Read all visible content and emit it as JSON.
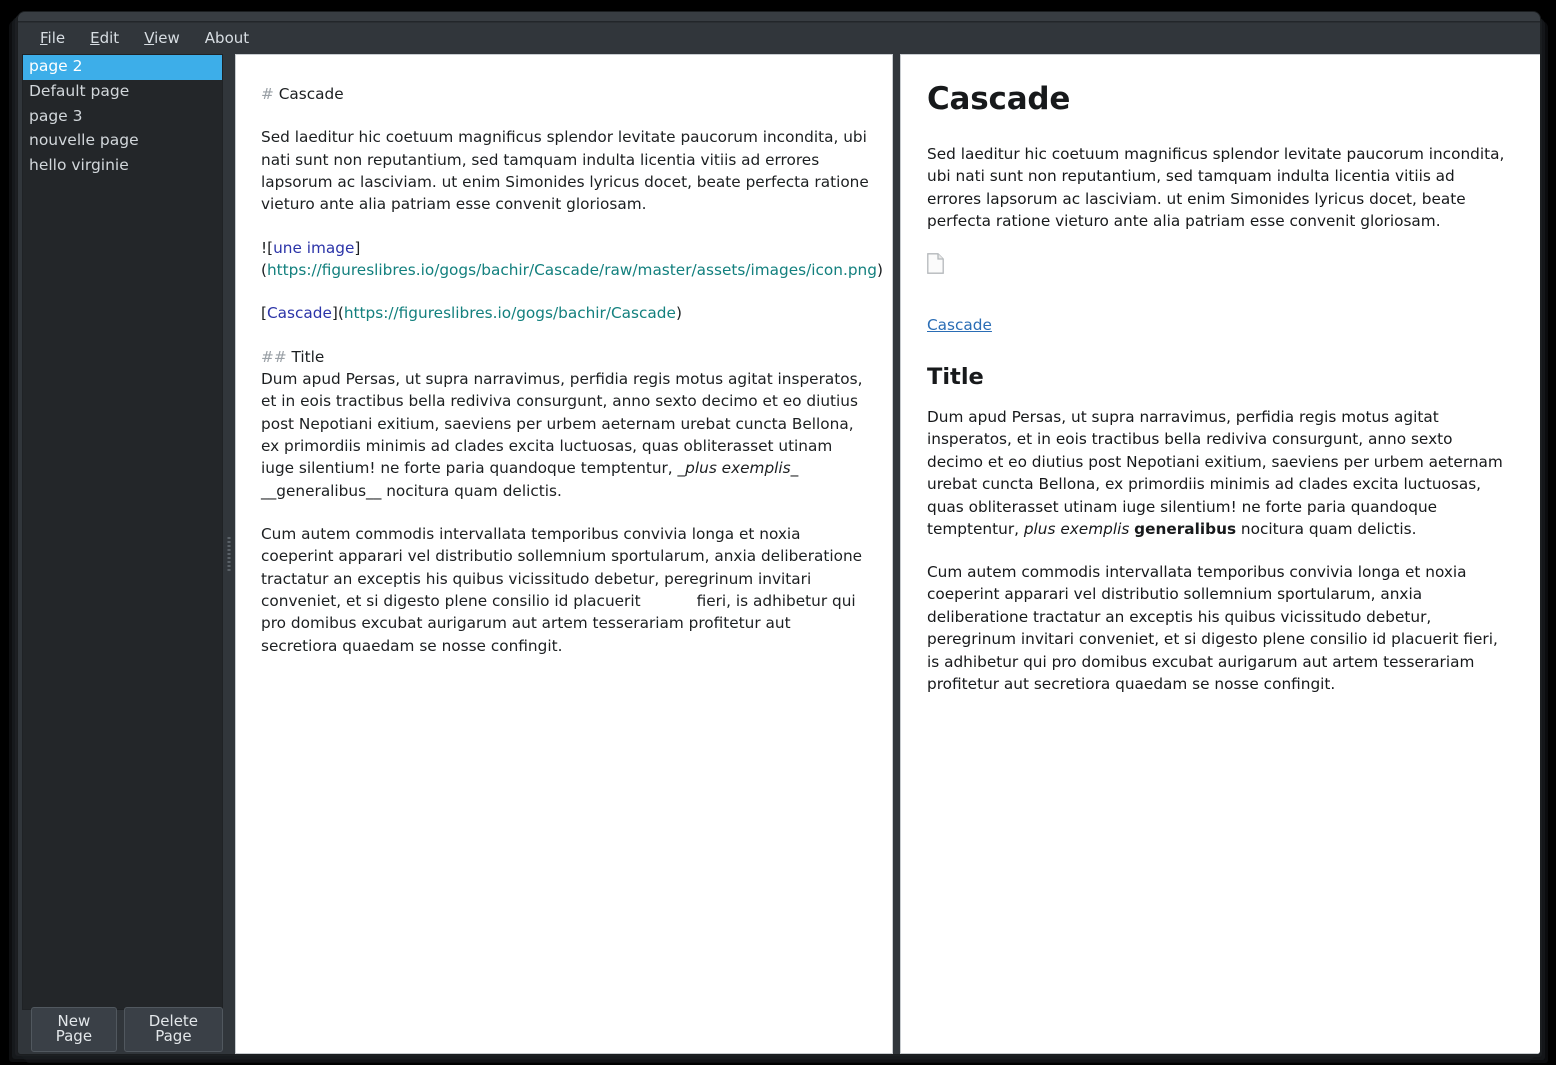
{
  "window": {
    "titlebar_label": ""
  },
  "menubar": {
    "items": [
      {
        "label": "File",
        "mnemonic": "F"
      },
      {
        "label": "Edit",
        "mnemonic": "E"
      },
      {
        "label": "View",
        "mnemonic": "V"
      },
      {
        "label": "About",
        "mnemonic": ""
      }
    ]
  },
  "sidebar": {
    "pages": [
      {
        "label": "page 2",
        "selected": true
      },
      {
        "label": "Default page",
        "selected": false
      },
      {
        "label": "page 3",
        "selected": false
      },
      {
        "label": "nouvelle page",
        "selected": false
      },
      {
        "label": "hello virginie",
        "selected": false
      }
    ],
    "new_page_label": "New Page",
    "delete_page_label": "Delete Page"
  },
  "editor": {
    "heading_marker": "#",
    "heading_text": " Cascade",
    "paragraph1": "Sed laeditur hic coetuum magnificus splendor levitate paucorum incondita, ubi nati sunt non reputantium, sed tamquam indulta licentia vitiis ad errores lapsorum ac lasciviam. ut enim Simonides lyricus docet, beate perfecta ratione vieturo ante alia patriam esse convenit gloriosam.",
    "image_line": {
      "prefix": "![",
      "alt": "une image",
      "mid": "](",
      "url": "https://figureslibres.io/gogs/bachir/Cascade/raw/master/assets/images/icon.png",
      "suffix": ")"
    },
    "link_line": {
      "prefix": "[",
      "text": "Cascade",
      "mid": "](",
      "url": "https://figureslibres.io/gogs/bachir/Cascade",
      "suffix": ")"
    },
    "subheading_marker": "##",
    "subheading_text": " Title",
    "paragraph2_a": "Dum apud Persas, ut supra narravimus, perfidia regis motus agitat insperatos, et in eois tractibus bella rediviva consurgunt, anno sexto decimo et eo diutius post Nepotiani exitium, saeviens per urbem aeternam urebat cuncta Bellona, ex primordiis minimis ad clades excita luctuosas, quas obliterasset utinam iuge silentium! ne forte paria quandoque temptentur, ",
    "paragraph2_italic": "_plus exemplis_",
    "paragraph2_b": " __generalibus__ nocitura quam delictis.",
    "paragraph3_a": "Cum autem commodis intervallata temporibus convivia longa et noxia coeperint apparari vel distributio sollemnium sportularum, anxia deliberatione tractatur an exceptis his quibus vicissitudo debetur, peregrinum invitari conveniet, et si digesto plene consilio id placuerit",
    "paragraph3_b": "fieri, is adhibetur qui pro domibus excubat aurigarum aut artem tesserariam profitetur aut secretiora quaedam se nosse confingit."
  },
  "preview": {
    "h1": "Cascade",
    "paragraph1": "Sed laeditur hic coetuum magnificus splendor levitate paucorum incondita, ubi nati sunt non reputantium, sed tamquam indulta licentia vitiis ad errores lapsorum ac lasciviam. ut enim Simonides lyricus docet, beate perfecta ratione vieturo ante alia patriam esse convenit gloriosam.",
    "broken_image_alt": "une image",
    "link_label": "Cascade",
    "h2": "Title",
    "paragraph2_a": "Dum apud Persas, ut supra narravimus, perfidia regis motus agitat insperatos, et in eois tractibus bella rediviva consurgunt, anno sexto decimo et eo diutius post Nepotiani exitium, saeviens per urbem aeternam urebat cuncta Bellona, ex primordiis minimis ad clades excita luctuosas, quas obliterasset utinam iuge silentium! ne forte paria quandoque temptentur, ",
    "paragraph2_italic": "plus exemplis",
    "paragraph2_bold": "generalibus",
    "paragraph2_b": " nocitura quam delictis.",
    "paragraph3": "Cum autem commodis intervallata temporibus convivia longa et noxia coeperint apparari vel distributio sollemnium sportularum, anxia deliberatione tractatur an exceptis his quibus vicissitudo debetur, peregrinum invitari conveniet, et si digesto plene consilio id placuerit fieri, is adhibetur qui pro domibus excubat aurigarum aut artem tesserariam profitetur aut secretiora quaedam se nosse confingit."
  },
  "colors": {
    "window_chrome": "#31363b",
    "list_background": "#232629",
    "selection_blue": "#3daee9",
    "editor_background": "#ffffff",
    "md_marker_gray": "#9aa0a6",
    "md_linktext_blue": "#2b34a8",
    "md_url_teal": "#13807e",
    "preview_link_blue": "#2a6db5"
  }
}
